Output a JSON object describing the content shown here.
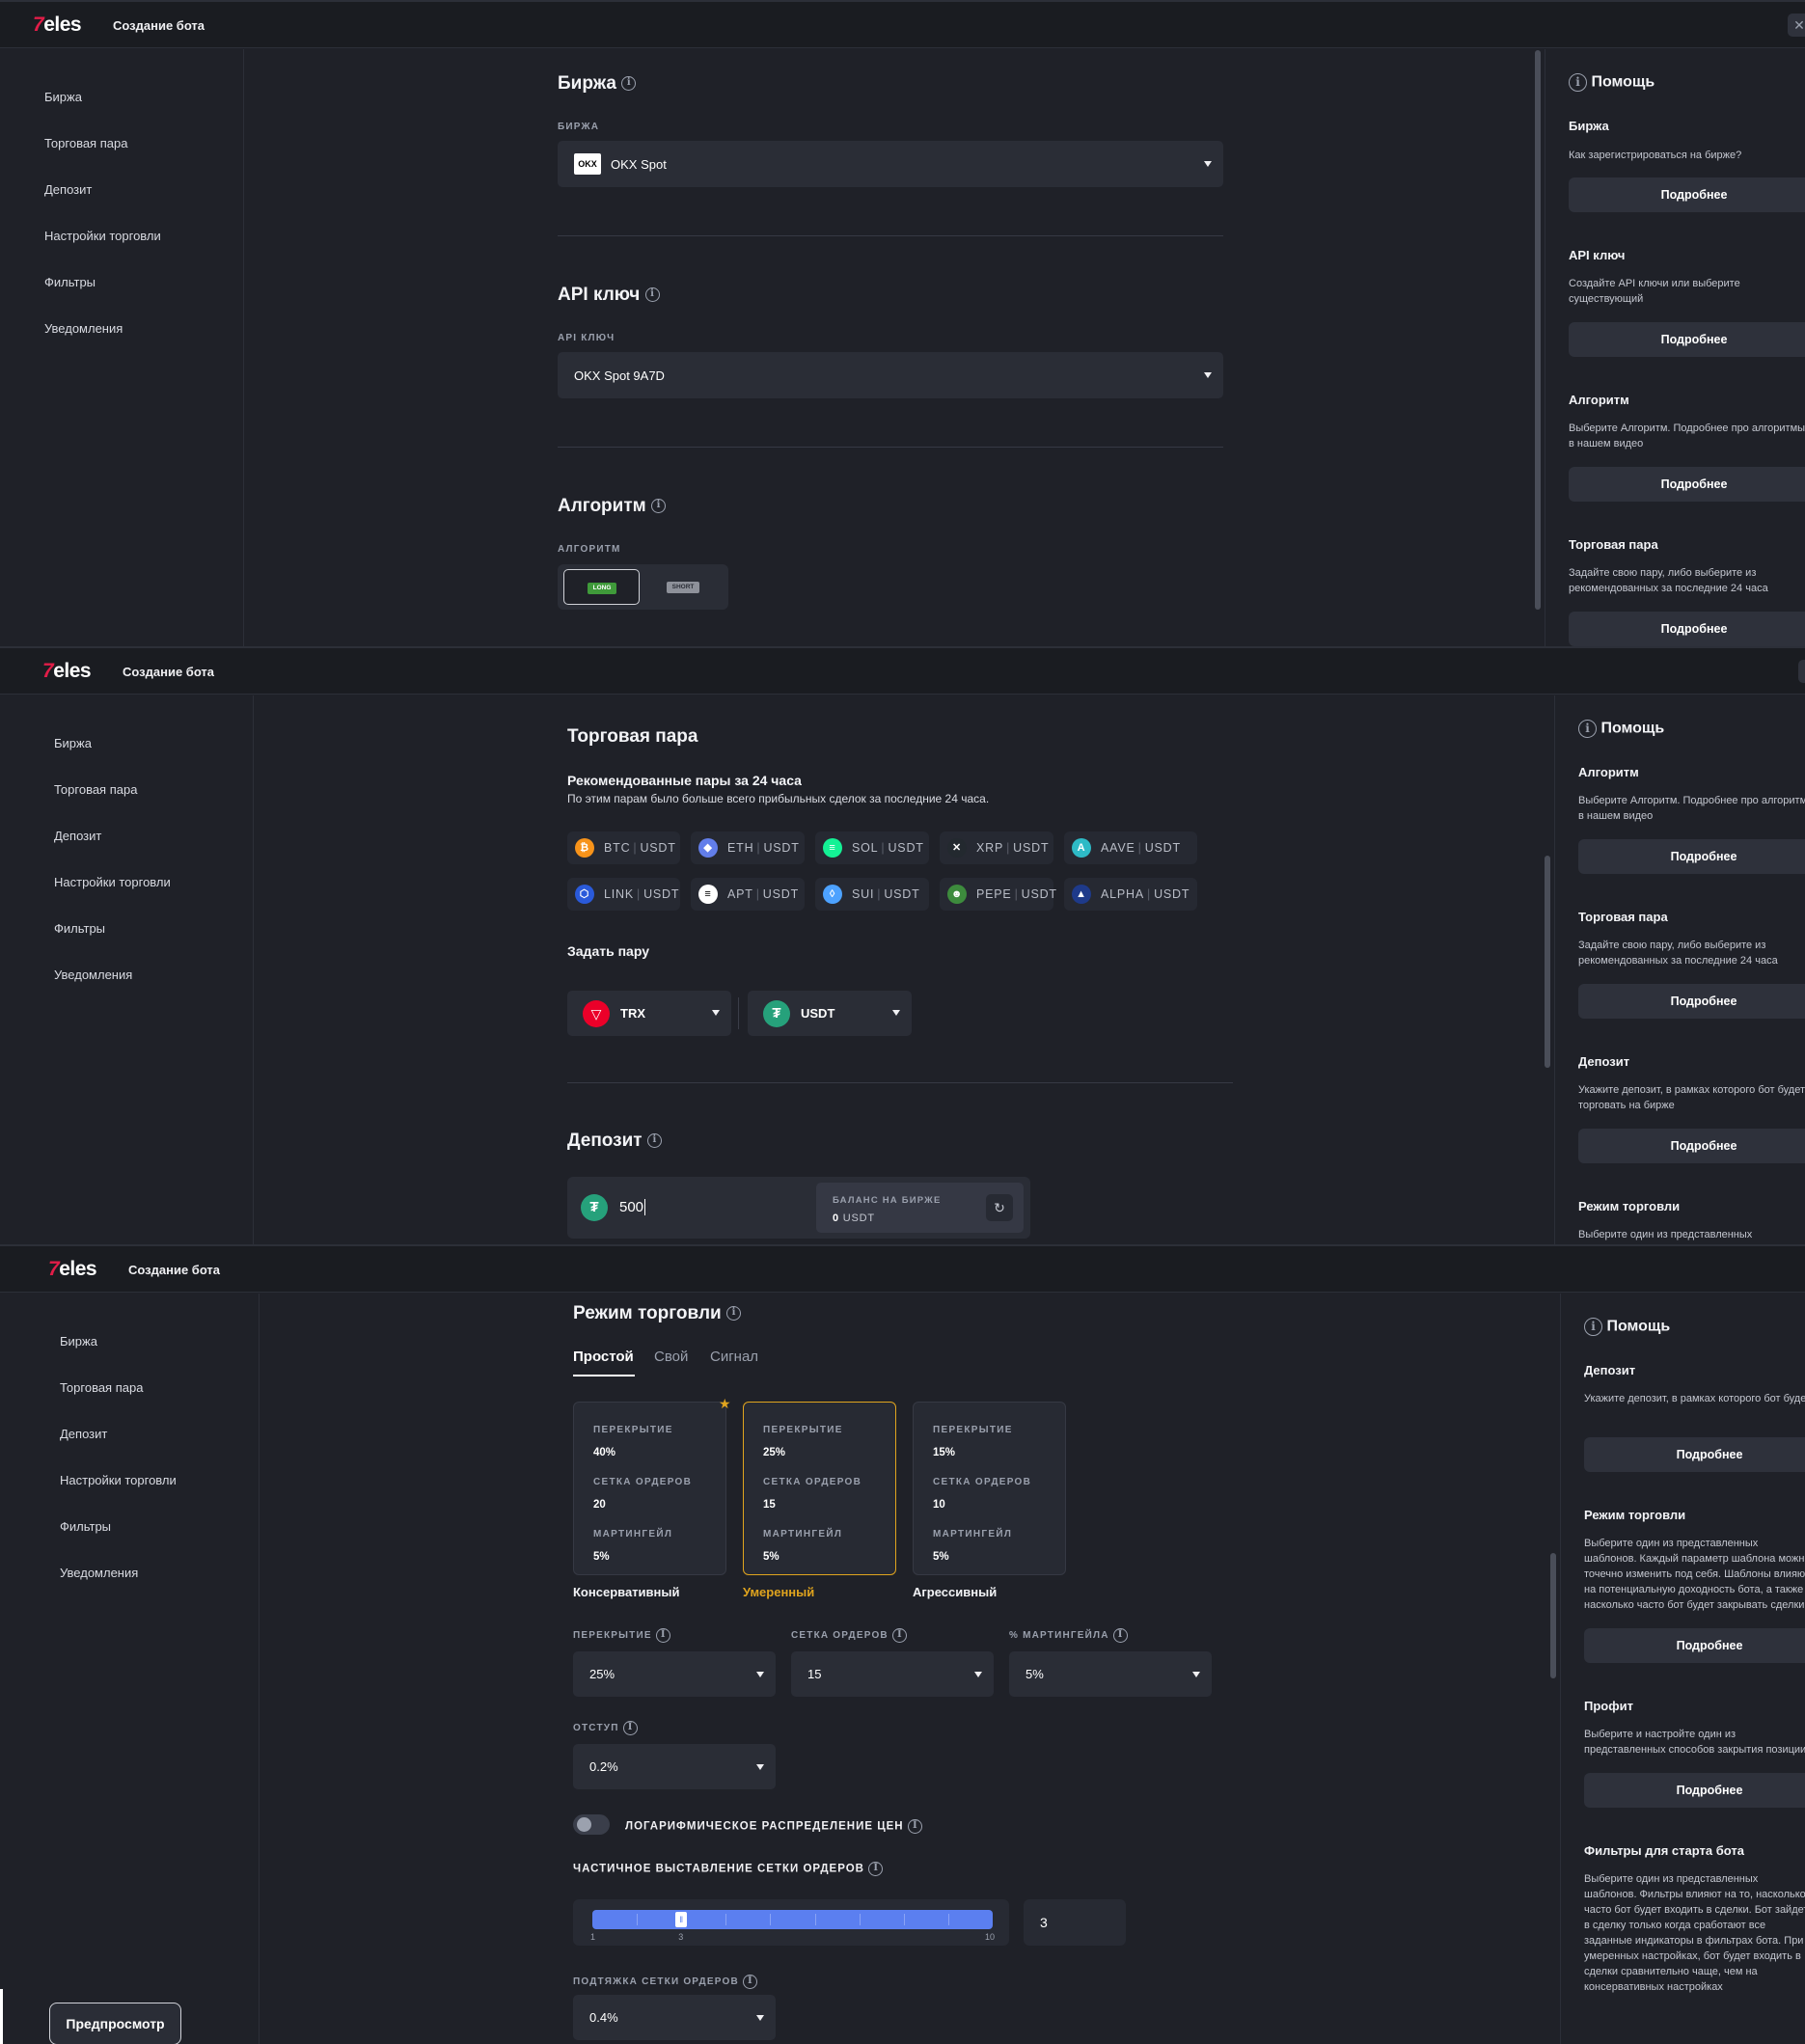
{
  "app": {
    "logo": "Veles",
    "title": "Создание бота"
  },
  "nav": [
    "Биржа",
    "Торговая пара",
    "Депозит",
    "Настройки торговли",
    "Фильтры",
    "Уведомления"
  ],
  "exchange": {
    "heading": "Биржа",
    "label": "БИРЖА",
    "value": "OKX Spot",
    "logo_text": "OKX"
  },
  "api": {
    "heading": "API ключ",
    "label": "API КЛЮЧ",
    "value": "OKX Spot 9A7D"
  },
  "algo": {
    "heading": "Алгоритм",
    "label": "АЛГОРИТМ",
    "long": "LONG",
    "short": "SHORT"
  },
  "help": {
    "title": "Помощь",
    "more": "Подробнее",
    "items": {
      "exchange": {
        "title": "Биржа",
        "desc": "Как зарегистрироваться на бирже?"
      },
      "api": {
        "title": "API ключ",
        "desc": "Создайте API ключи или выберите существующий"
      },
      "algo": {
        "title": "Алгоритм",
        "desc": "Выберите Алгоритм. Подробнее про алгоритмы в нашем видео"
      },
      "pair": {
        "title": "Торговая пара",
        "desc": "Задайте свою пару, либо выберите из рекомендованных за последние 24 часа"
      },
      "deposit": {
        "title": "Депозит",
        "desc": "Укажите депозит, в рамках которого бот будет торговать на бирже"
      },
      "mode": {
        "title": "Режим торговли",
        "desc": "Выберите один из представленных",
        "desc_full": "Выберите один из представленных шаблонов. Каждый параметр шаблона можно точечно изменить под себя. Шаблоны влияют на потенциальную доходность бота, а также насколько часто бот будет закрывать сделки"
      },
      "profit": {
        "title": "Профит",
        "desc": "Выберите и настройте один из представленных способов закрытия позиции"
      },
      "filters": {
        "title": "Фильтры для старта бота",
        "desc": "Выберите один из представленных шаблонов. Фильтры влияют на то, насколько часто бот будет входить в сделки. Бот зайдет в сделку только когда сработают все заданные индикаторы в фильтрах бота. При умеренных настройках, бот будет входить в сделки сравнительно чаще, чем на консервативных настройках"
      }
    }
  },
  "pair": {
    "heading": "Торговая пара",
    "recommended_title": "Рекомендованные пары за 24 часа",
    "recommended_desc": "По этим парам было больше всего прибыльных сделок за последние 24 часа.",
    "quote": "USDT",
    "pairs": [
      {
        "base": "BTC",
        "icon": "bitcoin-icon",
        "color": "#f7931a",
        "glyph": "₿"
      },
      {
        "base": "ETH",
        "icon": "ethereum-icon",
        "color": "#627eea",
        "glyph": "◆"
      },
      {
        "base": "SOL",
        "icon": "solana-icon",
        "color": "#14f195",
        "glyph": "≡"
      },
      {
        "base": "XRP",
        "icon": "xrp-icon",
        "color": "#23292f",
        "glyph": "✕"
      },
      {
        "base": "AAVE",
        "icon": "aave-icon",
        "color": "#2ebac6",
        "glyph": "A"
      },
      {
        "base": "LINK",
        "icon": "chainlink-icon",
        "color": "#2a5ada",
        "glyph": "⬡"
      },
      {
        "base": "APT",
        "icon": "aptos-icon",
        "color": "#ffffff",
        "glyph": "≡"
      },
      {
        "base": "SUI",
        "icon": "sui-icon",
        "color": "#4da2ff",
        "glyph": "◊"
      },
      {
        "base": "PEPE",
        "icon": "pepe-icon",
        "color": "#3d8b3d",
        "glyph": "☻"
      },
      {
        "base": "ALPHA",
        "icon": "alpha-icon",
        "color": "#1e3a8a",
        "glyph": "▲"
      }
    ],
    "set_pair": "Задать пару",
    "base_value": "TRX",
    "quote_value": "USDT"
  },
  "deposit": {
    "heading": "Депозит",
    "value": "500",
    "balance_label": "БАЛАНС НА БИРЖЕ",
    "balance_value": "0",
    "balance_unit": "USDT"
  },
  "mode": {
    "heading": "Режим торговли",
    "tabs": [
      "Простой",
      "Свой",
      "Сигнал"
    ],
    "cards": [
      {
        "name": "Консервативный",
        "overlap": "40",
        "orders": "20",
        "martingale": "5"
      },
      {
        "name": "Умеренный",
        "overlap": "25",
        "orders": "15",
        "martingale": "5"
      },
      {
        "name": "Агрессивный",
        "overlap": "15",
        "orders": "10",
        "martingale": "5"
      }
    ],
    "k_overlap": "ПЕРЕКРЫТИЕ",
    "k_orders": "СЕТКА ОРДЕРОВ",
    "k_martingale": "МАРТИНГЕЙЛ",
    "f_overlap": {
      "label": "ПЕРЕКРЫТИЕ",
      "value": "25%"
    },
    "f_orders": {
      "label": "СЕТКА ОРДЕРОВ",
      "value": "15"
    },
    "f_martingale": {
      "label": "% МАРТИНГЕЙЛА",
      "value": "5%"
    },
    "f_indent": {
      "label": "ОТСТУП",
      "value": "0.2%"
    },
    "log_label": "ЛОГАРИФМИЧЕСКОЕ РАСПРЕДЕЛЕНИЕ ЦЕН",
    "log_enabled": false,
    "partial_label": "ЧАСТИЧНОЕ ВЫСТАВЛЕНИЕ СЕТКИ ОРДЕРОВ",
    "slider": {
      "min": "1",
      "max": "10",
      "value": "3",
      "mark": "3",
      "min_value": 1,
      "max_value": 10,
      "current": 3
    },
    "pullup": {
      "label": "ПОДТЯЖКА СЕТКИ ОРДЕРОВ",
      "value": "0.4%"
    }
  },
  "preview": "Предпросмотр",
  "colors": {
    "accent": "#e0a41e",
    "slider": "#5b7ff0",
    "long": "#3f9a3a"
  }
}
